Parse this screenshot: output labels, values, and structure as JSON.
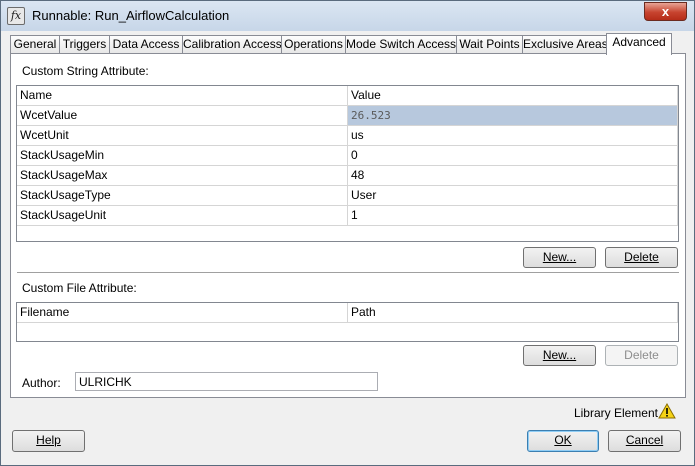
{
  "window": {
    "icon_glyph": "fx",
    "title": "Runnable: Run_AirflowCalculation",
    "close_glyph": "x"
  },
  "tabs": [
    {
      "label": "General"
    },
    {
      "label": "Triggers"
    },
    {
      "label": "Data Access"
    },
    {
      "label": "Calibration Access"
    },
    {
      "label": "Operations"
    },
    {
      "label": "Mode Switch Access"
    },
    {
      "label": "Wait Points"
    },
    {
      "label": "Exclusive Areas"
    },
    {
      "label": "Advanced"
    }
  ],
  "string_attrs": {
    "label": "Custom String Attribute:",
    "columns": [
      "Name",
      "Value"
    ],
    "rows": [
      {
        "name": "WcetValue",
        "value": "26.523"
      },
      {
        "name": "WcetUnit",
        "value": "us"
      },
      {
        "name": "StackUsageMin",
        "value": "0"
      },
      {
        "name": "StackUsageMax",
        "value": "48"
      },
      {
        "name": "StackUsageType",
        "value": "User"
      },
      {
        "name": "StackUsageUnit",
        "value": "1"
      }
    ],
    "new_label": "New...",
    "delete_label": "Delete"
  },
  "file_attrs": {
    "label": "Custom File Attribute:",
    "columns": [
      "Filename",
      "Path"
    ],
    "new_label": "New...",
    "delete_label": "Delete"
  },
  "author": {
    "label": "Author:",
    "value": "ULRICHK"
  },
  "footer": {
    "library_element": "Library Element",
    "help_label": "Help",
    "ok_label": "OK",
    "cancel_label": "Cancel"
  },
  "colors": {
    "selected_row": "#b7c8dd",
    "warning": "#f5d316"
  }
}
